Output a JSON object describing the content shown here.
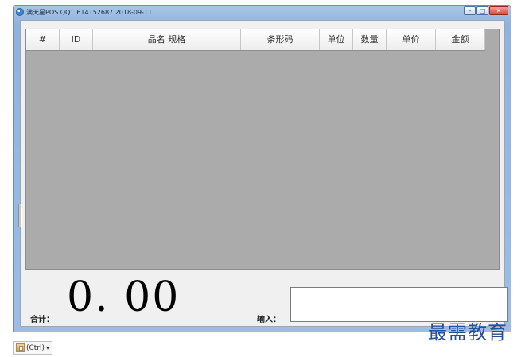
{
  "window": {
    "title": "满天星POS  QQ：614152687  2018-09-11"
  },
  "window_buttons": {
    "minimize": "–",
    "maximize": "□",
    "close": "✕"
  },
  "table": {
    "columns": [
      {
        "label": "#",
        "width": 42
      },
      {
        "label": "ID",
        "width": 42
      },
      {
        "label": "品名 规格",
        "width": 186
      },
      {
        "label": "条形码",
        "width": 99
      },
      {
        "label": "单位",
        "width": 42
      },
      {
        "label": "数量",
        "width": 42
      },
      {
        "label": "单价",
        "width": 62
      },
      {
        "label": "金额",
        "width": 62
      }
    ]
  },
  "summary": {
    "total_label": "合计：",
    "total_value": "0. 00",
    "input_label": "输入：",
    "input_value": ""
  },
  "overlay": {
    "watermark": "最需教育",
    "paste_hint": "(Ctrl)"
  },
  "colors": {
    "titlebar": "#9dbde4",
    "client_bg": "#f0f0f0",
    "grid_bg": "#ababab",
    "watermark": "#224f9f"
  }
}
